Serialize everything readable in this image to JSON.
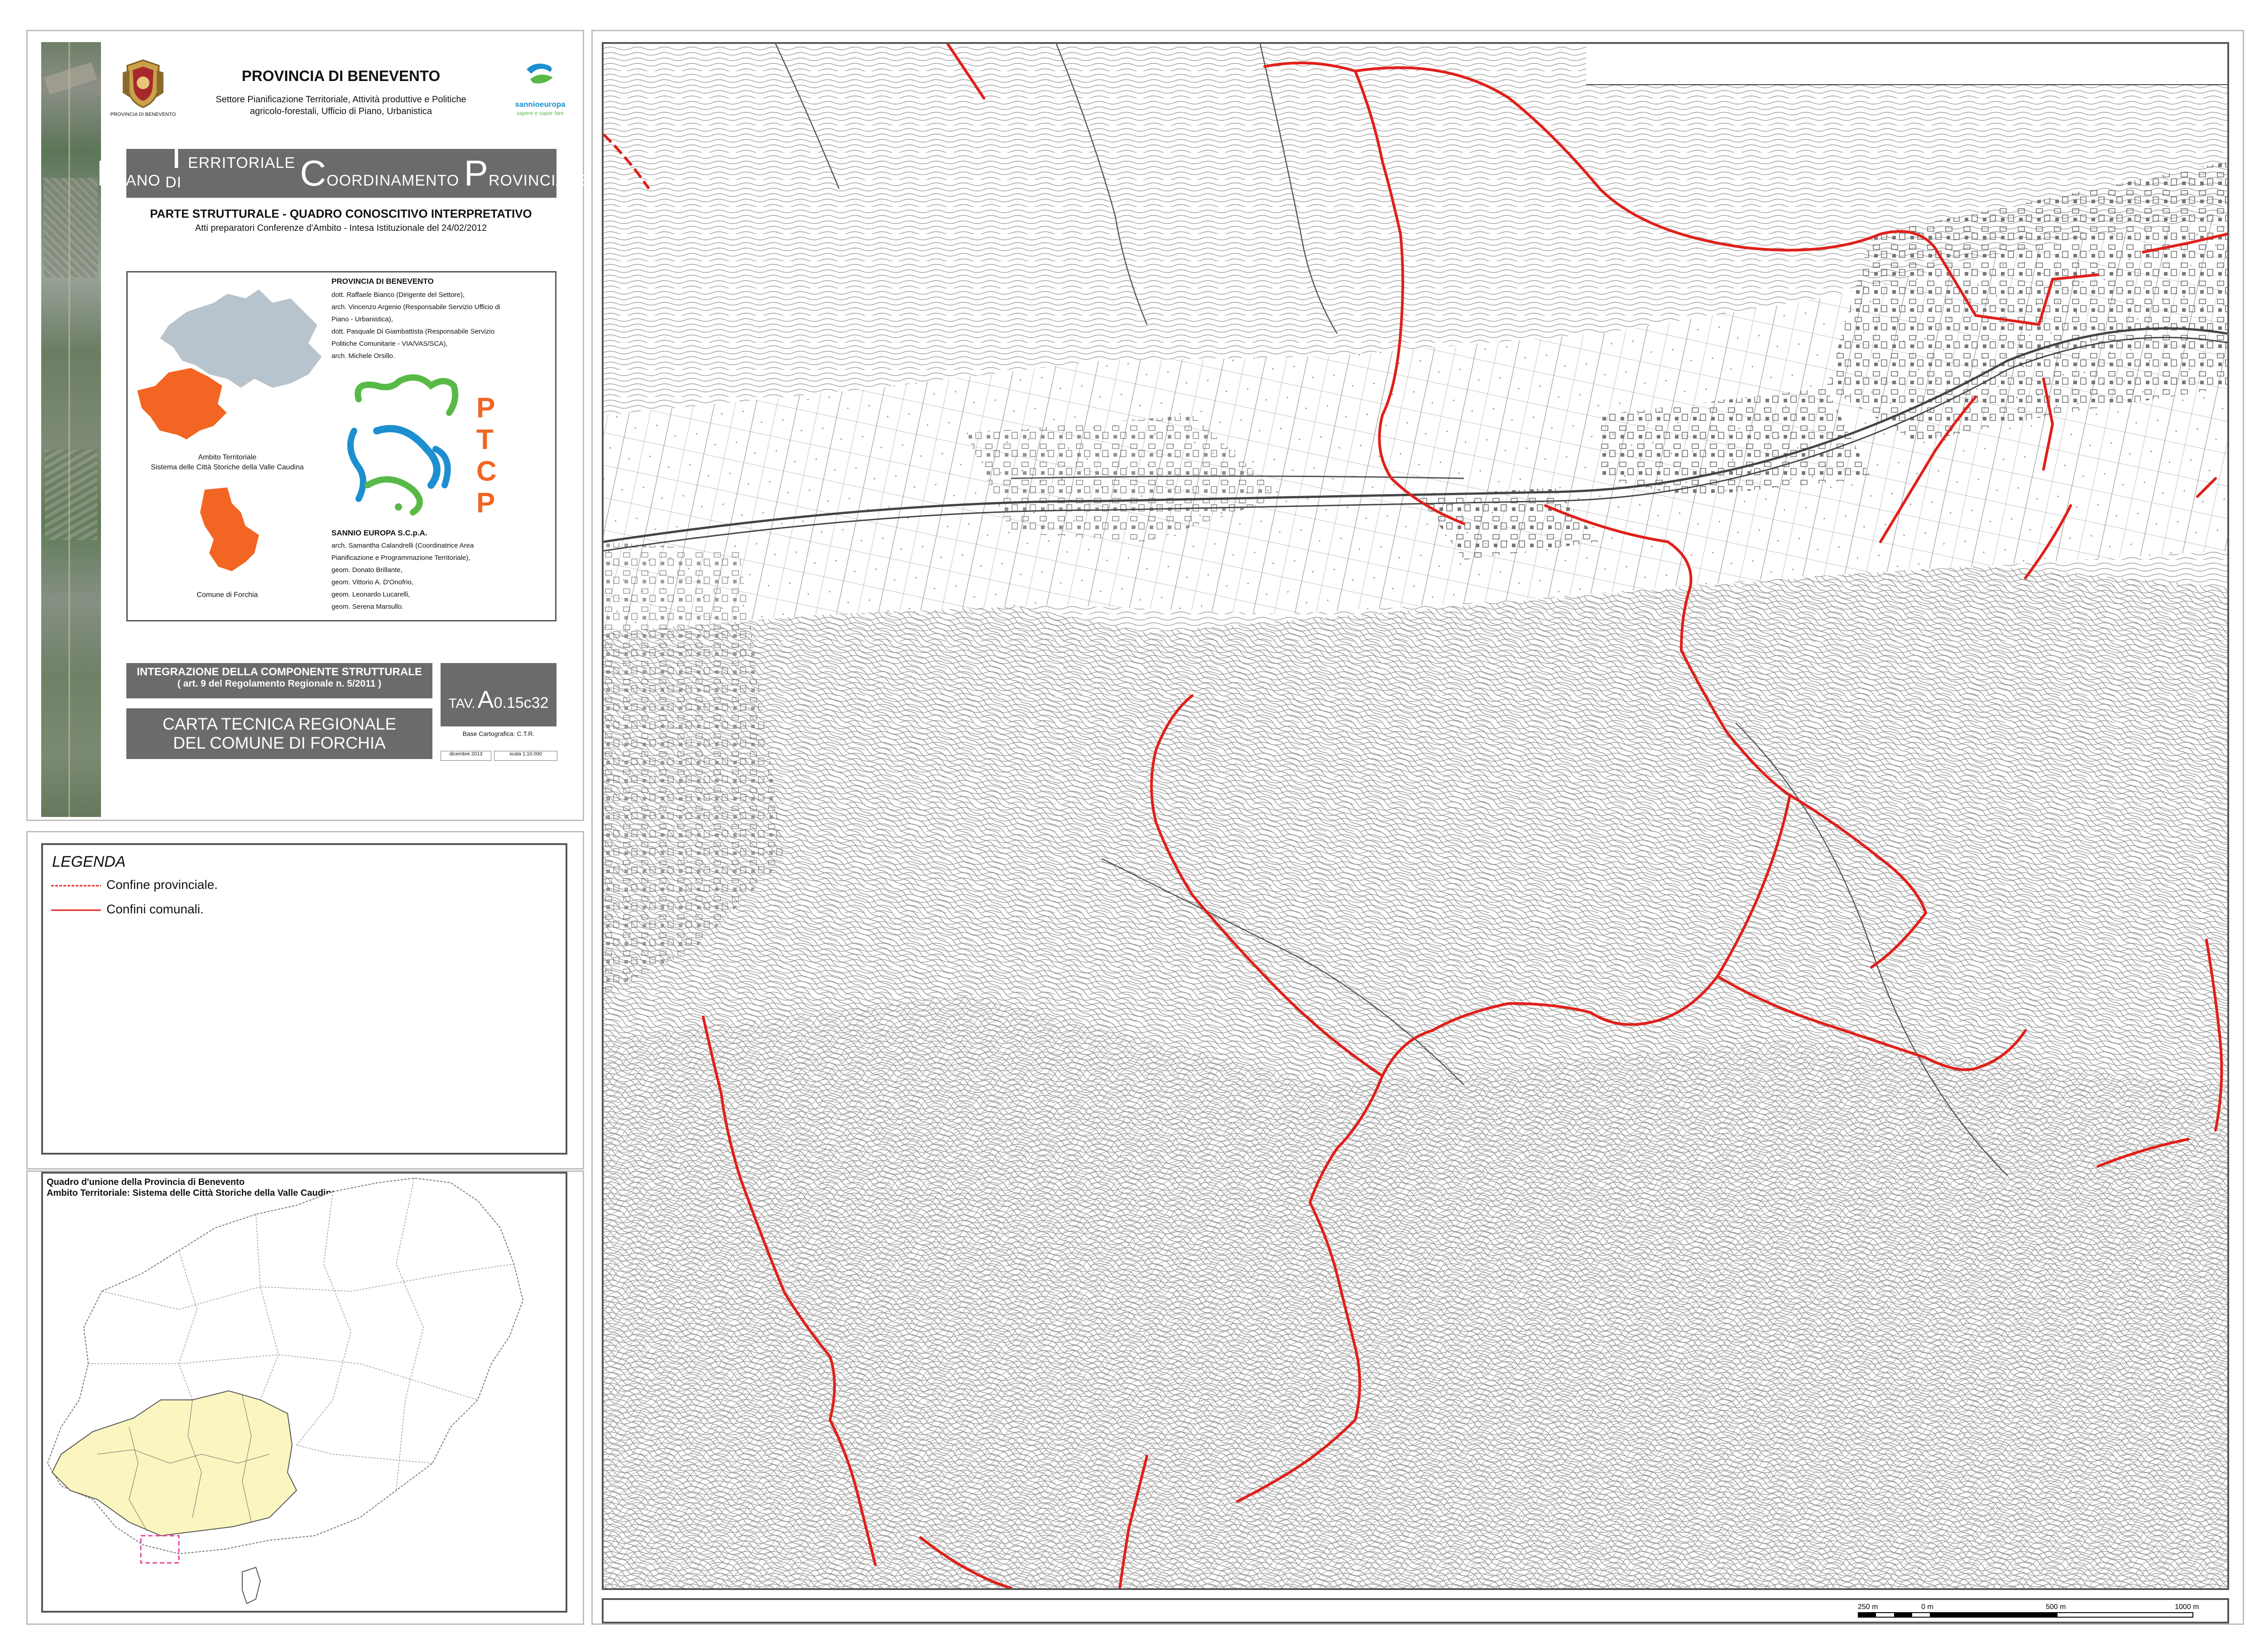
{
  "header": {
    "province_title": "PROVINCIA DI BENEVENTO",
    "crest_caption": "PROVINCIA DI BENEVENTO",
    "department_line1": "Settore Pianificazione Territoriale, Attività produttive e Politiche",
    "department_line2": "agricolo-forestali, Ufficio di Piano, Urbanistica",
    "partner_logo_line1": "sannioeuropa",
    "partner_logo_line2": "sapere e saper fare"
  },
  "ptcp": {
    "w1_initial": "P",
    "w1_rest": "IANO",
    "w2_initial": "T",
    "w2_rest": "ERRITORIALE DI",
    "w3_initial": "C",
    "w3_rest": "OORDINAMENTO",
    "w4_initial": "P",
    "w4_rest": "ROVINCIALE",
    "part_title": "PARTE STRUTTURALE - QUADRO CONOSCITIVO INTERPRETATIVO",
    "part_subtitle": "Atti preparatori Conferenze d'Ambito - Intesa Istituzionale del 24/02/2012"
  },
  "credits": {
    "province_heading": "PROVINCIA DI BENEVENTO",
    "province_lines": [
      "dott. Raffaele Bianco (Dirigente del Settore),",
      "arch. Vincenzo Argenio (Responsabile Servizio Ufficio di",
      "Piano - Urbanistica),",
      "dott. Pasquale Di Giambattista (Responsabile Servizio",
      "Politiche Comunitarie - VIA/VAS/SCA),",
      "arch. Michele Orsillo."
    ],
    "sannio_heading": "SANNIO EUROPA S.C.p.A.",
    "sannio_lines": [
      "arch. Samantha Calandrelli (Coordinatrice Area",
      "Pianificazione e Programmazione Territoriale),",
      "geom. Donato Brillante,",
      "geom. Vittorio A. D'Onofrio,",
      "geom. Leonardo Lucarelli,",
      "geom. Serena Marsullo."
    ],
    "ambito_caption_line1": "Ambito Territoriale",
    "ambito_caption_line2": "Sistema delle Città Storiche della Valle Caudina",
    "comune_caption": "Comune di Forchia",
    "ptcp_logo_letters": [
      "P",
      "T",
      "C",
      "P"
    ]
  },
  "tavola": {
    "integration_line1": "INTEGRAZIONE DELLA COMPONENTE STRUTTURALE",
    "integration_line2": "( art. 9 del Regolamento Regionale n. 5/2011 )",
    "map_title_line1": "CARTA TECNICA REGIONALE",
    "map_title_line2": "DEL COMUNE DI FORCHIA",
    "tav_prefix": "TAV.",
    "tav_letter": "A",
    "tav_code": "0.15c32",
    "base": "Base Cartografica: C.T.R.",
    "date": "dicembre 2013",
    "scale": "scala 1:10.000"
  },
  "legend": {
    "title": "LEGENDA",
    "items": [
      {
        "label": "Confine provinciale.",
        "style": "dashed"
      },
      {
        "label": "Confini comunali.",
        "style": "solid"
      }
    ]
  },
  "overview": {
    "title_line1": "Quadro d'unione della Provincia di Benevento",
    "title_line2": "Ambito Territoriale: Sistema delle Città Storiche della Valle Caudina"
  },
  "scale_bar": {
    "labels": [
      "250 m",
      "0 m",
      "500 m",
      "1000 m"
    ]
  },
  "colors": {
    "boundary_red": "#e0201a",
    "grey_panel": "#6b6b6b",
    "province_fill": "#b7c3cd",
    "ambito_fill": "#f26522",
    "overview_highlight": "#fbf6c0",
    "logo_green": "#58b947",
    "logo_blue": "#1d8fd0",
    "logo_orange": "#f26522"
  },
  "icons": [
    "province-crest-icon",
    "sannio-europa-logo-icon",
    "ptcp-logo-icon"
  ]
}
